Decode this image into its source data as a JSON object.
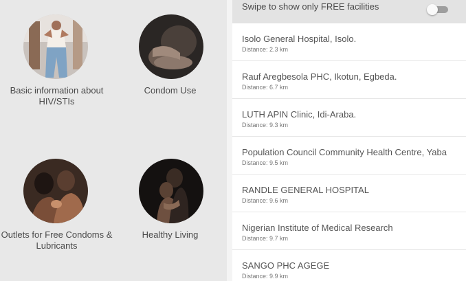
{
  "categories": [
    {
      "label": "Basic information about HIV/STIs"
    },
    {
      "label": "Condom Use"
    },
    {
      "label": "Outlets for Free Condoms & Lubricants"
    },
    {
      "label": "Healthy Living"
    }
  ],
  "filter": {
    "label": "Swipe to show only FREE facilities",
    "enabled": false
  },
  "facilities": [
    {
      "name": "Isolo General Hospital, Isolo.",
      "distance": "Distance: 2.3 km"
    },
    {
      "name": "Rauf Aregbesola PHC, Ikotun, Egbeda.",
      "distance": "Distance: 6.7 km"
    },
    {
      "name": "LUTH APIN Clinic, Idi-Araba.",
      "distance": "Distance: 9.3 km"
    },
    {
      "name": "Population Council Community Health Centre, Yaba",
      "distance": "Distance: 9.5 km"
    },
    {
      "name": "RANDLE GENERAL HOSPITAL",
      "distance": "Distance: 9.6 km"
    },
    {
      "name": "Nigerian Institute of Medical Research",
      "distance": "Distance: 9.7 km"
    },
    {
      "name": "SANGO PHC AGEGE",
      "distance": "Distance: 9.9 km"
    }
  ]
}
